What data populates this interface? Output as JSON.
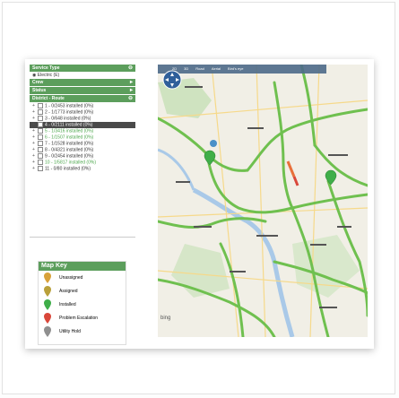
{
  "panel": {
    "service_type": {
      "title": "Service Type",
      "items": [
        "Electric (E)"
      ]
    },
    "crew": {
      "title": "Crew"
    },
    "status": {
      "title": "Status"
    },
    "district": {
      "title": "District - Route",
      "rows": [
        {
          "label": "1 - 0/2453 installed (0%)",
          "style": "normal"
        },
        {
          "label": "2 - 1/1773 installed (0%)",
          "style": "normal"
        },
        {
          "label": "3 - 0/648 installed (0%)",
          "style": "normal"
        },
        {
          "label": "4 - 0/2111 installed (0%)",
          "style": "selected"
        },
        {
          "label": "5 - 1/3416 installed (0%)",
          "style": "green"
        },
        {
          "label": "6 - 1/1507 installed (0%)",
          "style": "green"
        },
        {
          "label": "7 - 1/1528 installed (0%)",
          "style": "normal"
        },
        {
          "label": "8 - 0/4321 installed (0%)",
          "style": "normal"
        },
        {
          "label": "9 - 0/2454 installed (0%)",
          "style": "normal"
        },
        {
          "label": "10 - 1/5817 installed (0%)",
          "style": "green"
        },
        {
          "label": "11 - 0/80 installed (0%)",
          "style": "normal"
        }
      ]
    }
  },
  "map_key": {
    "title": "Map Key",
    "items": [
      {
        "label": "Unassigned",
        "color": "#d8a13a"
      },
      {
        "label": "Assigned",
        "color": "#b9a03a"
      },
      {
        "label": "Installed",
        "color": "#3fae49"
      },
      {
        "label": "Problem Escalation",
        "color": "#d9473a"
      },
      {
        "label": "Utility Hold",
        "color": "#8f8f8f"
      }
    ]
  },
  "map": {
    "tabs": [
      "2D",
      "3D",
      "Road",
      "Aerial",
      "Bird's eye"
    ],
    "attribution": "bing"
  },
  "colors": {
    "header_green": "#5c9e5c",
    "road_green": "#6fc04f",
    "map_bg": "#f1efe6"
  }
}
